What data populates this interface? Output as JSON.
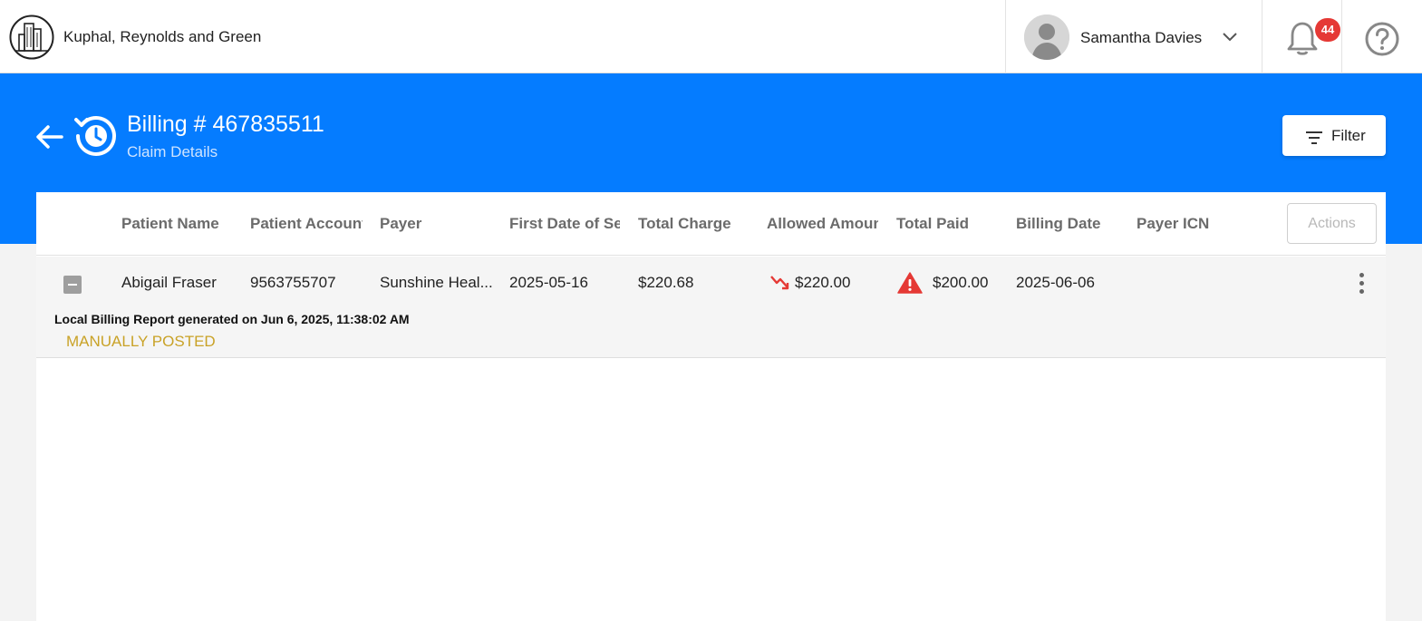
{
  "org": {
    "name": "Kuphal, Reynolds and Green",
    "logo_icon": "building-icon"
  },
  "user": {
    "name": "Samantha Davies",
    "dropdown_icon": "chevron-down-icon"
  },
  "notifications": {
    "count": "44"
  },
  "header": {
    "title": "Billing # 467835511",
    "subtitle": "Claim Details",
    "filter_label": "Filter"
  },
  "table": {
    "columns": [
      "Patient Name",
      "Patient Account",
      "Payer",
      "First Date of Service",
      "Total Charge",
      "Allowed Amount",
      "Total Paid",
      "Billing Date",
      "Payer ICN"
    ],
    "actions_label": "Actions",
    "row": {
      "patient_name": "Abigail Fraser",
      "patient_account": "9563755707",
      "payer": "Sunshine Heal...",
      "first_date": "2025-05-16",
      "total_charge": "$220.68",
      "allowed_amount": "$220.00",
      "total_paid": "$200.00",
      "billing_date": "2025-06-06",
      "payer_icn": "",
      "report_note": "Local Billing Report generated on Jun 6, 2025, 11:38:02 AM",
      "status": "MANUALLY POSTED"
    }
  },
  "colors": {
    "brand_blue": "#057cff",
    "badge_red": "#e53935",
    "status_gold": "#c9a227",
    "warning_red": "#e53935"
  }
}
